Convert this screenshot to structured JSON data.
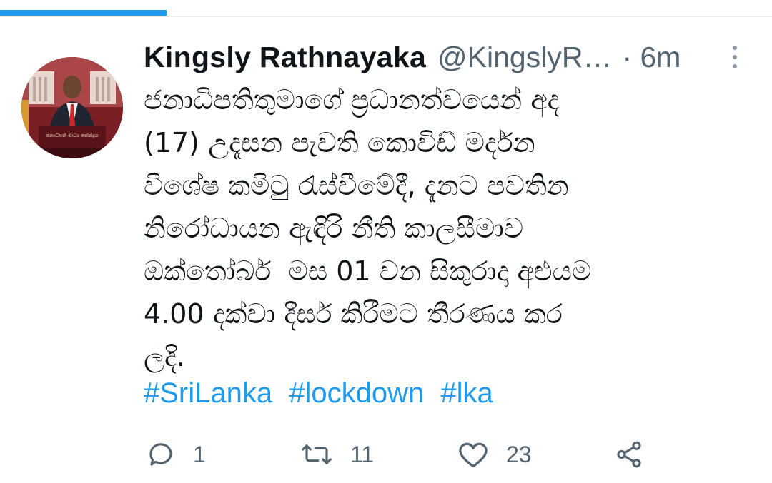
{
  "progress": {
    "value": 0.216
  },
  "tweet": {
    "author_name": "Kingsly Rathnayaka",
    "author_handle": "@KingslyR…",
    "time": "· 6m",
    "text_lines": [
      "ජනාධිපතිතුමාගේ ප්‍රධානත්වයෙන් අද",
      "(17) උදෑසන පැවති කොවිඩ් මර්දන",
      "විශේෂ කමිටු රැස්වීමේදී, දැනට පවතින",
      "නිරෝධායන ඇඳිරි නීති කාලසීමාව",
      "ඔක්තෝබර්  මස 01 වන සිකුරාදා අළුයම",
      "4.00 දක්වා දීර්ඝ කිරීමට තීරණය කර",
      "ලදි."
    ],
    "hashtags": [
      "#SriLanka",
      "#lockdown",
      "#lka"
    ],
    "avatar_sign_text": "ජනාධිපති මාධ්‍ය කේන්ද්‍රය"
  },
  "actions": {
    "reply_count": "1",
    "retweet_count": "11",
    "like_count": "23"
  },
  "icons": {
    "reply": "comment-bubble-icon",
    "retweet": "retweet-icon",
    "like": "heart-icon",
    "share": "share-icon",
    "more": "more-vertical-icon"
  },
  "colors": {
    "accent": "#1d9bf0",
    "muted": "#536471",
    "text": "#0f1419"
  }
}
